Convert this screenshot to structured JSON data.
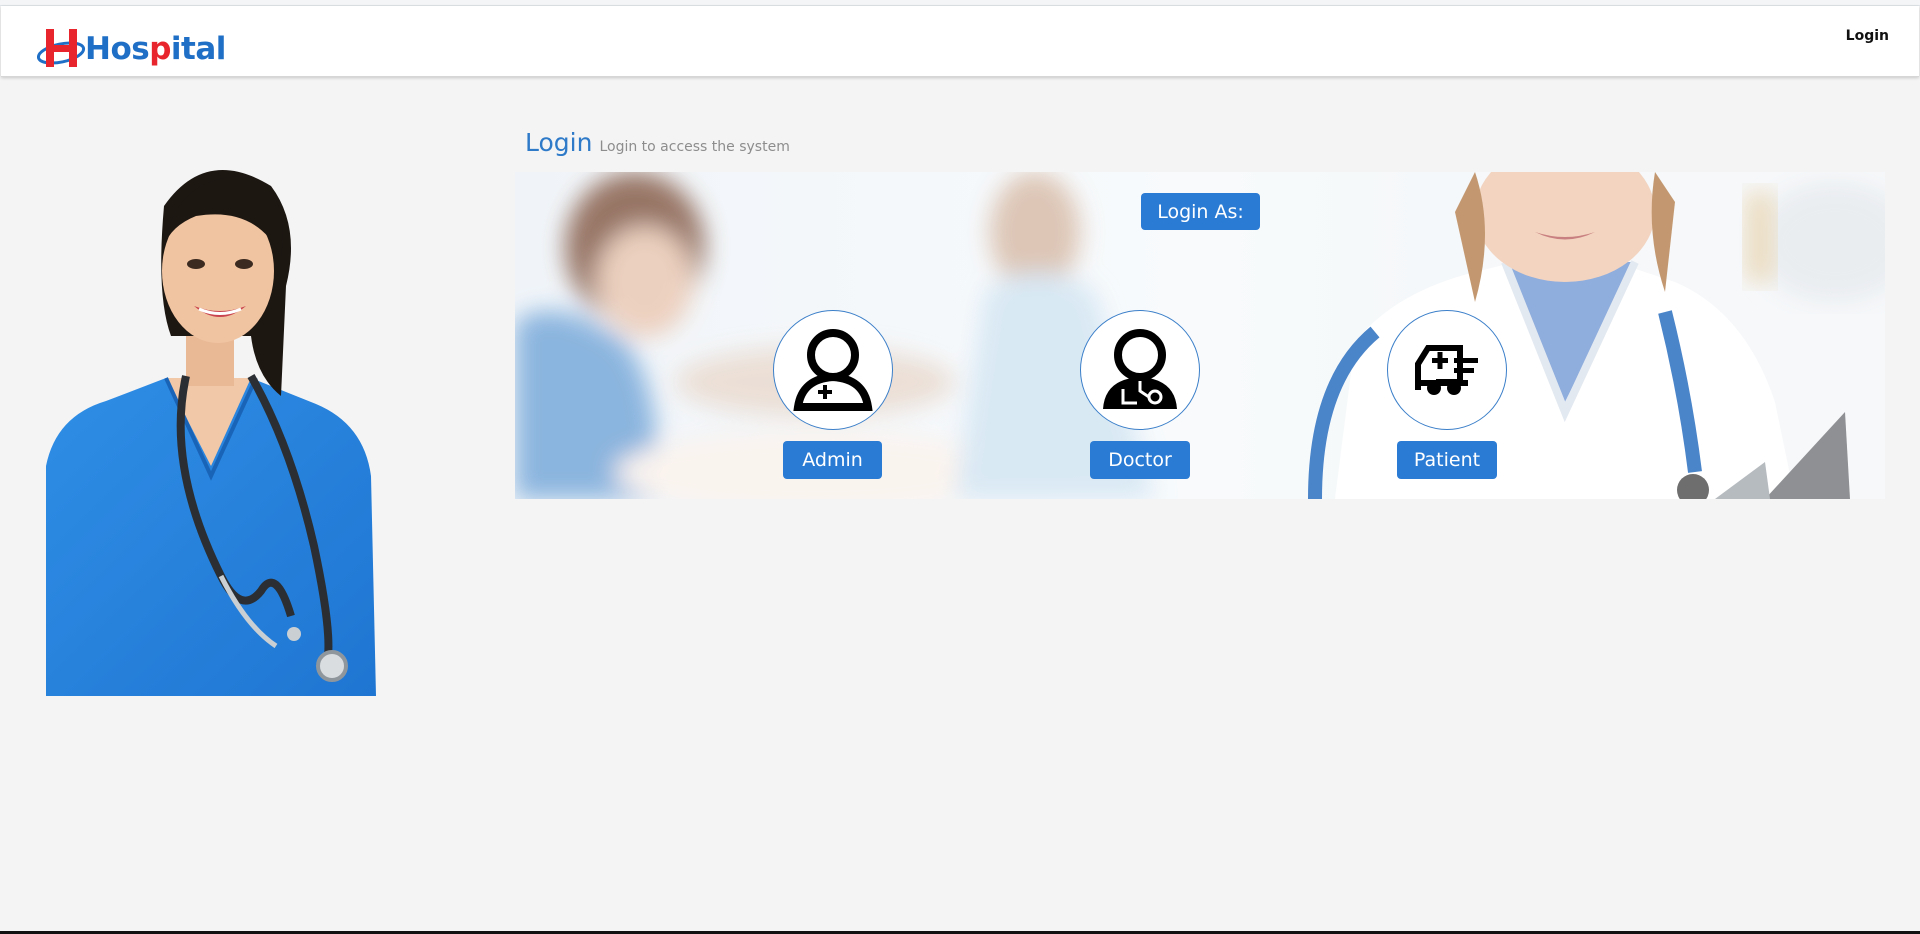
{
  "brand": {
    "part1": "Hos",
    "part2": "p",
    "part3": "ital"
  },
  "nav": {
    "login": "Login"
  },
  "heading": {
    "title": "Login",
    "subtitle": "Login to access the system"
  },
  "banner": {
    "login_as": "Login As:"
  },
  "roles": [
    {
      "label": "Admin",
      "icon": "admin-icon"
    },
    {
      "label": "Doctor",
      "icon": "doctor-icon"
    },
    {
      "label": "Patient",
      "icon": "ambulance-icon"
    }
  ],
  "colors": {
    "accent": "#2a7bd4",
    "brand_blue": "#1f6fc6",
    "brand_red": "#e8242c",
    "background": "#f4f4f4"
  }
}
